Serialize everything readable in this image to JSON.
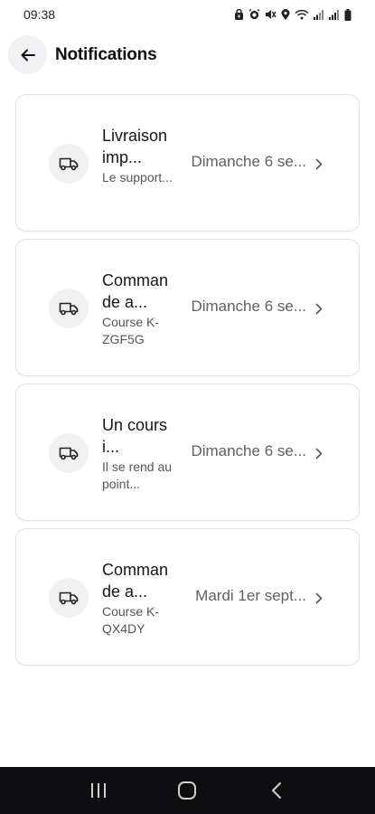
{
  "status_bar": {
    "time": "09:38"
  },
  "header": {
    "title": "Notifications",
    "back_icon": "arrow-left-icon"
  },
  "notifications": [
    {
      "icon": "truck-icon",
      "title": "Livraison imp...",
      "subtitle": "Le support...",
      "date": "Dimanche 6 se..."
    },
    {
      "icon": "truck-icon",
      "title": "Commande a...",
      "subtitle": "Course K-ZGF5G",
      "date": "Dimanche 6 se..."
    },
    {
      "icon": "truck-icon",
      "title": "Un coursi...",
      "subtitle": "Il se rend au point...",
      "date": "Dimanche 6 se..."
    },
    {
      "icon": "truck-icon",
      "title": "Commande a...",
      "subtitle": "Course K-QX4DY",
      "date": "Mardi 1er sept..."
    }
  ],
  "colors": {
    "background": "#ffffff",
    "card_border": "#e4e4e7",
    "icon_bg": "#f1f1f3",
    "nav_bar": "#0e0e10"
  }
}
